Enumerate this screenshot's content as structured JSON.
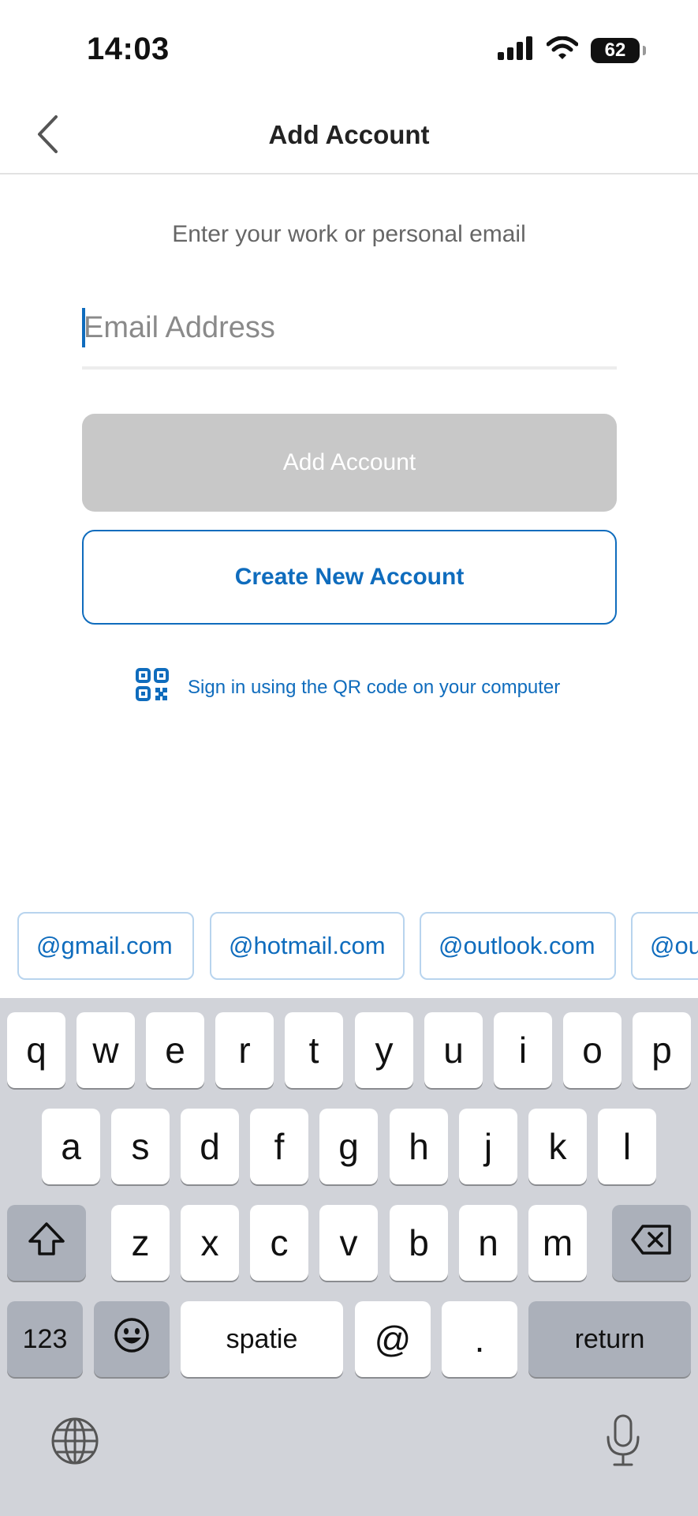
{
  "status_bar": {
    "time": "14:03",
    "battery": "62",
    "icons": [
      "cellular-signal-icon",
      "wifi-icon",
      "battery-icon"
    ]
  },
  "nav": {
    "title": "Add Account",
    "back_icon": "chevron-left-icon"
  },
  "form": {
    "subtitle": "Enter your work or personal email",
    "email_placeholder": "Email Address",
    "email_value": "",
    "add_account_label": "Add Account",
    "create_account_label": "Create New Account",
    "qr_link_label": "Sign in using the QR code on your computer",
    "qr_icon": "qr-code-icon"
  },
  "suggestions": [
    "@gmail.com",
    "@hotmail.com",
    "@outlook.com",
    "@ou"
  ],
  "keyboard": {
    "row1": [
      "q",
      "w",
      "e",
      "r",
      "t",
      "y",
      "u",
      "i",
      "o",
      "p"
    ],
    "row2": [
      "a",
      "s",
      "d",
      "f",
      "g",
      "h",
      "j",
      "k",
      "l"
    ],
    "row3": [
      "z",
      "x",
      "c",
      "v",
      "b",
      "n",
      "m"
    ],
    "numbers_label": "123",
    "space_label": "spatie",
    "at_label": "@",
    "dot_label": ".",
    "return_label": "return",
    "icons": [
      "shift-icon",
      "backspace-icon",
      "emoji-icon",
      "globe-icon",
      "microphone-icon"
    ]
  },
  "colors": {
    "accent": "#0f6cbd",
    "disabled_button": "#c8c8c8",
    "keyboard_bg": "#d1d3d9"
  }
}
